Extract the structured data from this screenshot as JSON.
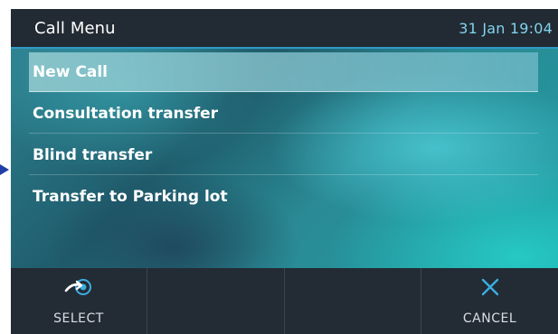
{
  "header": {
    "title": "Call Menu",
    "datetime": "31 Jan 19:04"
  },
  "menu": {
    "items": [
      {
        "label": "New Call",
        "selected": true
      },
      {
        "label": "Consultation transfer",
        "selected": false
      },
      {
        "label": "Blind transfer",
        "selected": false
      },
      {
        "label": "Transfer to Parking lot",
        "selected": false
      }
    ]
  },
  "softkeys": {
    "select": {
      "label": "SELECT",
      "icon": "select-arrow-icon"
    },
    "empty1": {
      "label": ""
    },
    "empty2": {
      "label": ""
    },
    "cancel": {
      "label": "CANCEL",
      "icon": "close-icon"
    }
  },
  "colors": {
    "header_bg": "#222a33",
    "header_accent": "#2e9bc5",
    "datetime": "#7fd3ee",
    "softkey_bg": "#232b35",
    "icon_blue": "#3aaee0",
    "pointer": "#1f3fa8"
  }
}
